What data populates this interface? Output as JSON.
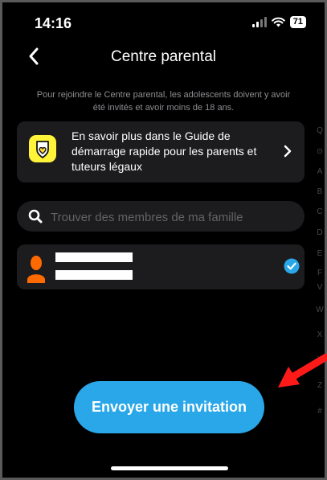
{
  "status_bar": {
    "time": "14:16",
    "battery": "71"
  },
  "header": {
    "title": "Centre parental"
  },
  "info_text": "Pour rejoindre le Centre parental, les adolescents doivent y avoir été invités et avoir moins de 18 ans.",
  "guide_card": {
    "text": "En savoir plus dans le Guide de démarrage rapide pour les parents et tuteurs légaux"
  },
  "search": {
    "placeholder": "Trouver des membres de ma famille",
    "value": ""
  },
  "member": {
    "selected": true
  },
  "alphabet_index": [
    "Q",
    "⊙",
    "A",
    "B",
    "C",
    "D",
    "E",
    "F",
    "V",
    "W",
    "X",
    "Y",
    "Z",
    "#"
  ],
  "cta": {
    "label": "Envoyer une invitation"
  },
  "colors": {
    "accent": "#2aa7e8",
    "card": "#1c1c1e",
    "avatar": "#ff6a00",
    "arrow": "#ff1a1a"
  }
}
